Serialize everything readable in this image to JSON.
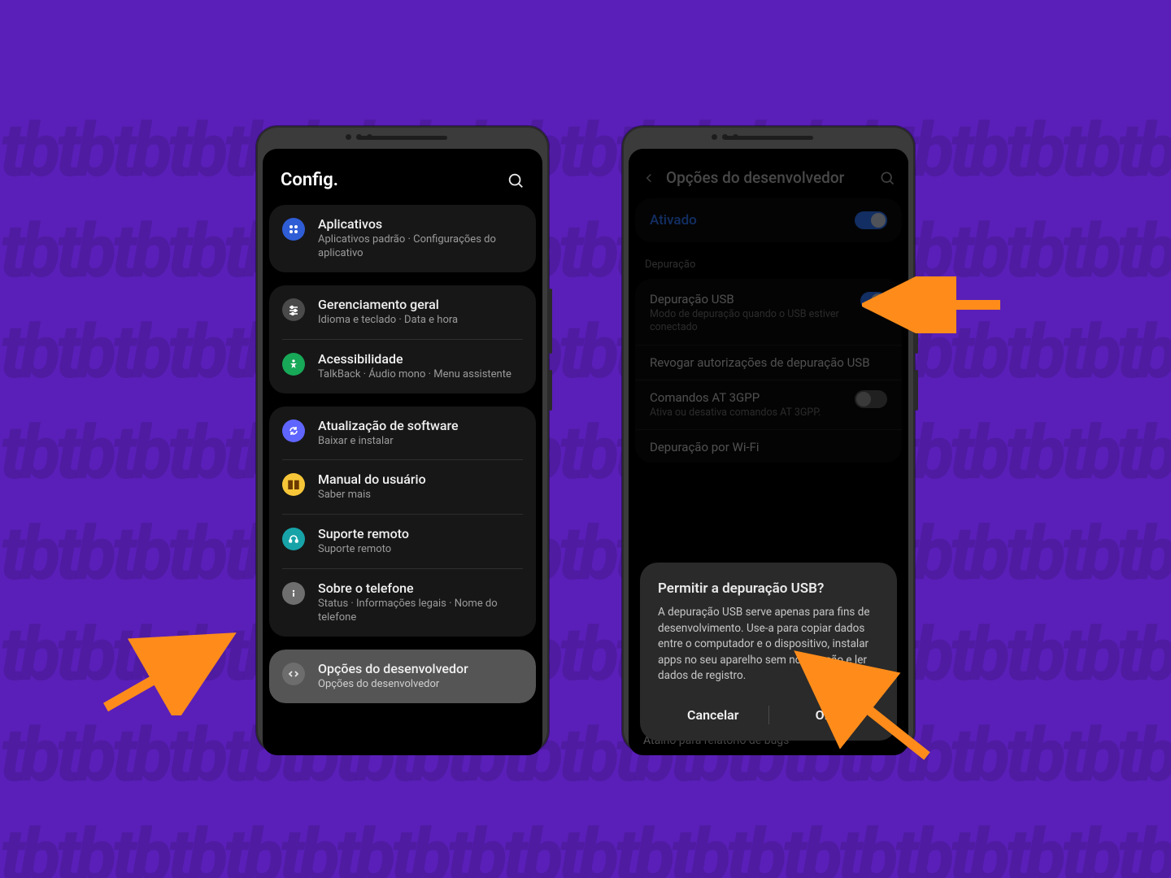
{
  "left": {
    "header_title": "Config.",
    "groups": [
      {
        "rows": [
          {
            "icon": "apps",
            "title": "Aplicativos",
            "subtitle": "Aplicativos padrão  ·  Configurações do aplicativo"
          }
        ]
      },
      {
        "rows": [
          {
            "icon": "general",
            "title": "Gerenciamento geral",
            "subtitle": "Idioma e teclado  ·  Data e hora"
          },
          {
            "icon": "access",
            "title": "Acessibilidade",
            "subtitle": "TalkBack  ·  Áudio mono  ·  Menu assistente"
          }
        ]
      },
      {
        "rows": [
          {
            "icon": "update",
            "title": "Atualização de software",
            "subtitle": "Baixar e instalar"
          },
          {
            "icon": "manual",
            "title": "Manual do usuário",
            "subtitle": "Saber mais"
          },
          {
            "icon": "support",
            "title": "Suporte remoto",
            "subtitle": "Suporte remoto"
          },
          {
            "icon": "about",
            "title": "Sobre o telefone",
            "subtitle": "Status  ·  Informações legais  ·  Nome do telefone"
          }
        ]
      },
      {
        "highlight": true,
        "rows": [
          {
            "icon": "dev",
            "title": "Opções do desenvolvedor",
            "subtitle": "Opções do desenvolvedor"
          }
        ]
      }
    ]
  },
  "right": {
    "header_title": "Opções do desenvolvedor",
    "activated_label": "Ativado",
    "section_label": "Depuração",
    "rows": [
      {
        "title": "Depuração USB",
        "subtitle": "Modo de depuração quando o USB estiver conectado",
        "toggle": "on"
      },
      {
        "title": "Revogar autorizações de depuração USB",
        "subtitle": ""
      },
      {
        "title": "Comandos AT 3GPP",
        "subtitle": "Ativa ou desativa comandos AT 3GPP.",
        "toggle": "off"
      },
      {
        "title": "Depuração por Wi-Fi",
        "subtitle": ""
      }
    ],
    "behind_dialog_text": "Atalho para relatório de bugs",
    "dialog": {
      "title": "Permitir a depuração USB?",
      "body": "A depuração USB serve apenas para fins de desenvolvimento. Use-a para copiar dados entre o computador e o dispositivo, instalar apps no seu aparelho sem notificação e ler dados de registro.",
      "cancel": "Cancelar",
      "ok": "OK"
    }
  }
}
